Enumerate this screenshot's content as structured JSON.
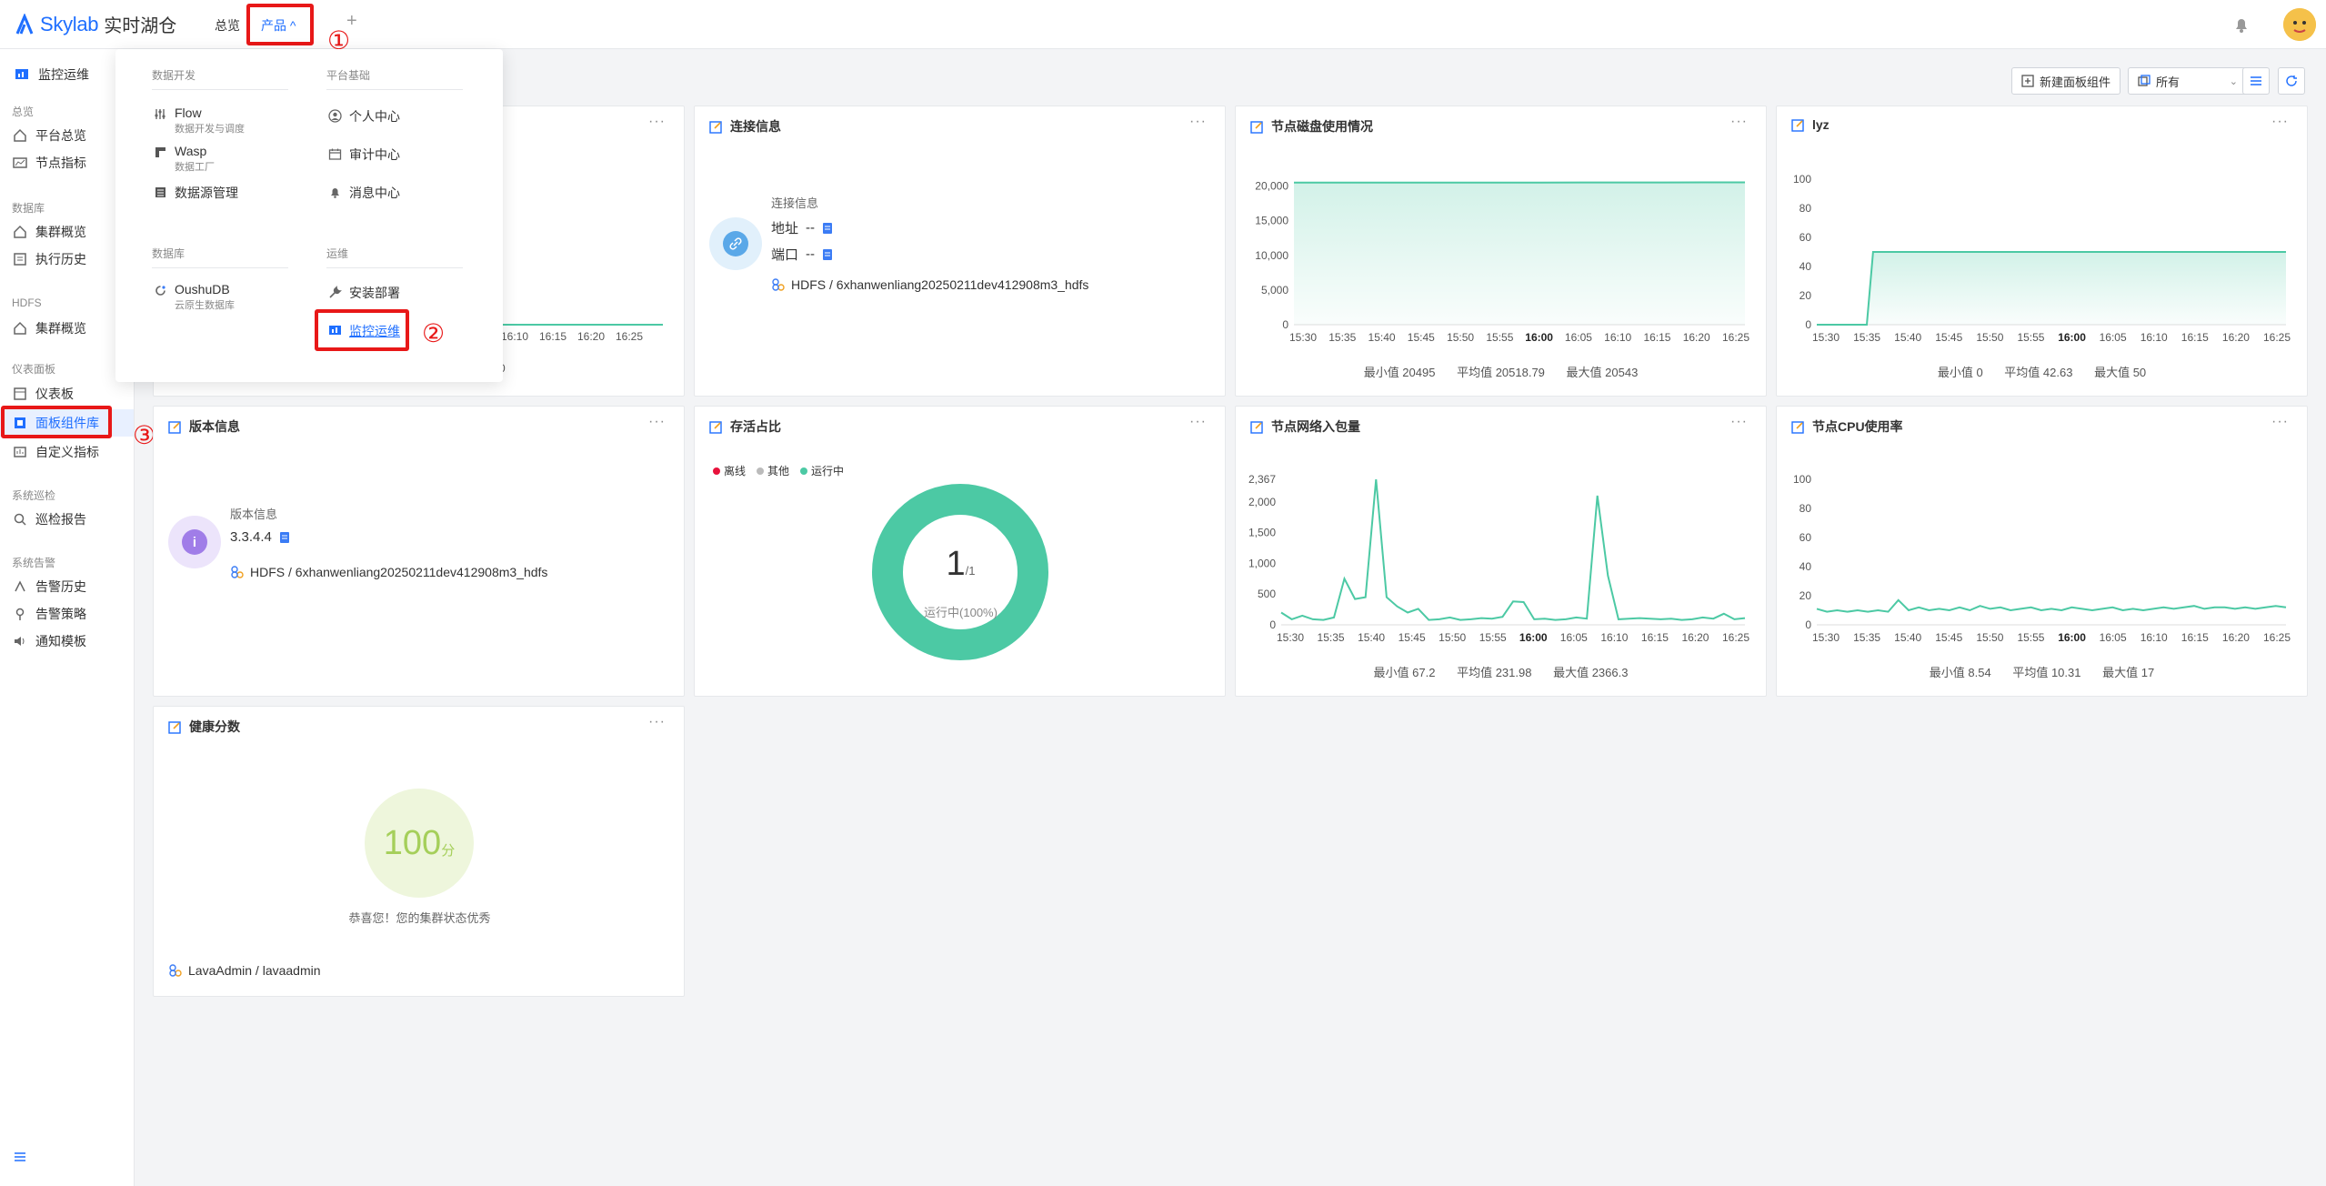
{
  "app": {
    "logo_text": "Skylab",
    "logo_sub": "实时湖仓"
  },
  "topnav": {
    "overview": "总览",
    "product": "产品 ^",
    "add": "+"
  },
  "sidebar": {
    "header": "监控运维",
    "groups": [
      {
        "label": "总览",
        "items": [
          "平台总览",
          "节点指标"
        ]
      },
      {
        "label": "数据库",
        "items": [
          "集群概览",
          "执行历史"
        ]
      },
      {
        "label": "HDFS",
        "items": [
          "集群概览"
        ]
      },
      {
        "label": "仪表面板",
        "items": [
          "仪表板",
          "面板组件库",
          "自定义指标"
        ]
      },
      {
        "label": "系统巡检",
        "items": [
          "巡检报告"
        ]
      },
      {
        "label": "系统告警",
        "items": [
          "告警历史",
          "告警策略",
          "通知模板"
        ]
      }
    ],
    "active_item": "面板组件库"
  },
  "dropdown": {
    "sections": {
      "data_dev": "数据开发",
      "platform": "平台基础",
      "database": "数据库",
      "ops": "运维"
    },
    "items": {
      "flow": {
        "title": "Flow",
        "sub": "数据开发与调度"
      },
      "wasp": {
        "title": "Wasp",
        "sub": "数据工厂"
      },
      "datasource": {
        "title": "数据源管理"
      },
      "personal": {
        "title": "个人中心"
      },
      "audit": {
        "title": "审计中心"
      },
      "message": {
        "title": "消息中心"
      },
      "oushudb": {
        "title": "OushuDB",
        "sub": "云原生数据库"
      },
      "install": {
        "title": "安装部署"
      },
      "monitor": {
        "title": "监控运维"
      }
    }
  },
  "markers": {
    "one": "①",
    "two": "②",
    "three": "③"
  },
  "toolbar": {
    "new_panel": "新建面板组件",
    "filter_value": "所有"
  },
  "panels": {
    "p1": {
      "x_ticks_visible": [
        "16:10",
        "16:15",
        "16:20",
        "16:25"
      ],
      "stats_tail": "0"
    },
    "connection": {
      "title": "连接信息",
      "label": "连接信息",
      "address_label": "地址",
      "address_value": "--",
      "port_label": "端口",
      "port_value": "--",
      "meta": "HDFS / 6xhanwenliang20250211dev412908m3_hdfs"
    },
    "disk": {
      "title": "节点磁盘使用情况",
      "stats": {
        "min": "最小值 20495",
        "avg": "平均值 20518.79",
        "max": "最大值 20543"
      }
    },
    "lyz": {
      "title": "lyz",
      "stats": {
        "min": "最小值 0",
        "avg": "平均值 42.63",
        "max": "最大值 50"
      }
    },
    "version": {
      "title": "版本信息",
      "label": "版本信息",
      "value": "3.3.4.4",
      "meta": "HDFS / 6xhanwenliang20250211dev412908m3_hdfs"
    },
    "alive": {
      "title": "存活占比",
      "legend": [
        "离线",
        "其他",
        "运行中"
      ],
      "center_value": "1",
      "center_total": "/1",
      "center_label": "运行中(100%)"
    },
    "network": {
      "title": "节点网络入包量",
      "stats": {
        "min": "最小值 67.2",
        "avg": "平均值 231.98",
        "max": "最大值 2366.3"
      }
    },
    "cpu": {
      "title": "节点CPU使用率",
      "stats": {
        "min": "最小值 8.54",
        "avg": "平均值 10.31",
        "max": "最大值 17"
      }
    },
    "health": {
      "title": "健康分数",
      "score": "100",
      "unit": "分",
      "message": "恭喜您！您的集群状态优秀",
      "meta": "LavaAdmin / lavaadmin"
    }
  },
  "colors": {
    "accent": "#1f6fff",
    "series": "#4cc9a4",
    "red": "#e81818",
    "offline": "#e8123c",
    "other": "#bbbbbb"
  },
  "chart_data": [
    {
      "type": "area",
      "panel": "节点磁盘使用情况",
      "x": [
        "15:30",
        "15:35",
        "15:40",
        "15:45",
        "15:50",
        "15:55",
        "16:00",
        "16:05",
        "16:10",
        "16:15",
        "16:20",
        "16:25"
      ],
      "series": [
        {
          "values": [
            20495,
            20500,
            20505,
            20510,
            20512,
            20515,
            20518,
            20522,
            20528,
            20532,
            20538,
            20543
          ]
        }
      ],
      "y_ticks": [
        0,
        5000,
        10000,
        15000,
        20000
      ],
      "ylim": [
        0,
        21000
      ]
    },
    {
      "type": "area",
      "panel": "lyz",
      "x": [
        "15:30",
        "15:35",
        "15:40",
        "15:45",
        "15:50",
        "15:55",
        "16:00",
        "16:05",
        "16:10",
        "16:15",
        "16:20",
        "16:25"
      ],
      "series": [
        {
          "values": [
            0,
            0,
            50,
            50,
            50,
            50,
            50,
            50,
            50,
            50,
            50,
            50,
            50
          ]
        }
      ],
      "points_x": [
        0,
        1.6,
        1.8,
        2,
        4,
        6,
        8,
        10,
        11,
        12,
        13,
        14,
        15
      ],
      "y_ticks": [
        0,
        20,
        40,
        60,
        80,
        100
      ],
      "ylim": [
        0,
        100
      ]
    },
    {
      "type": "line",
      "panel": "节点网络入包量",
      "x": [
        "15:30",
        "15:35",
        "15:40",
        "15:45",
        "15:50",
        "15:55",
        "16:00",
        "16:05",
        "16:10",
        "16:15",
        "16:20",
        "16:25"
      ],
      "series": [
        {
          "values": [
            200,
            90,
            150,
            90,
            80,
            120,
            750,
            420,
            450,
            2366,
            450,
            300,
            200,
            260,
            80,
            90,
            120,
            80,
            90,
            110,
            100,
            130,
            380,
            370,
            90,
            100,
            80,
            90,
            120,
            100,
            2100,
            800,
            90,
            100,
            110,
            100,
            90,
            100,
            80,
            90,
            120,
            100,
            180,
            90,
            110
          ]
        }
      ],
      "y_ticks": [
        0,
        500,
        1000,
        1500,
        2000,
        2367
      ],
      "ylim": [
        0,
        2367
      ]
    },
    {
      "type": "line",
      "panel": "节点CPU使用率",
      "x": [
        "15:30",
        "15:35",
        "15:40",
        "15:45",
        "15:50",
        "15:55",
        "16:00",
        "16:05",
        "16:10",
        "16:15",
        "16:20",
        "16:25"
      ],
      "series": [
        {
          "values": [
            11,
            9,
            10,
            9,
            10,
            9,
            10,
            9,
            17,
            10,
            12,
            10,
            11,
            10,
            12,
            10,
            13,
            11,
            12,
            10,
            11,
            12,
            10,
            11,
            10,
            12,
            11,
            10,
            11,
            12,
            10,
            11,
            10,
            11,
            12,
            11,
            12,
            13,
            11,
            12,
            12,
            11,
            12,
            11,
            12,
            13,
            12
          ]
        }
      ],
      "y_ticks": [
        0,
        20,
        40,
        60,
        80,
        100
      ],
      "ylim": [
        0,
        100
      ]
    },
    {
      "type": "pie",
      "panel": "存活占比",
      "categories": [
        "离线",
        "其他",
        "运行中"
      ],
      "values": [
        0,
        0,
        1
      ]
    }
  ]
}
